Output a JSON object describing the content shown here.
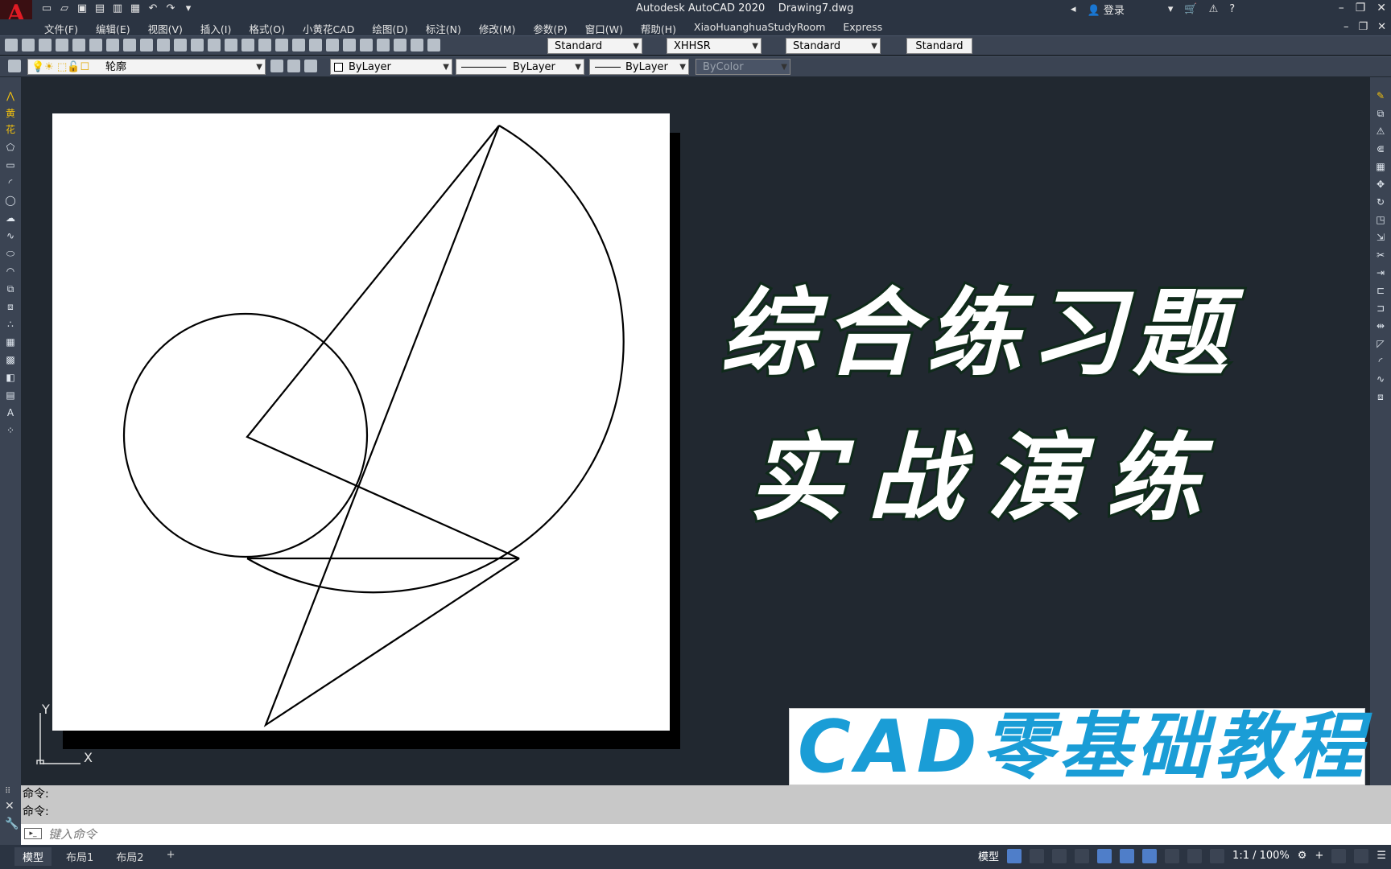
{
  "window": {
    "app_title": "Autodesk AutoCAD 2020",
    "doc_title": "Drawing7.dwg",
    "login": "登录",
    "logo_letter": "A"
  },
  "menu": [
    "文件(F)",
    "编辑(E)",
    "视图(V)",
    "插入(I)",
    "格式(O)",
    "小黄花CAD",
    "绘图(D)",
    "标注(N)",
    "修改(M)",
    "参数(P)",
    "窗口(W)",
    "帮助(H)",
    "XiaoHuanghuaStudyRoom",
    "Express"
  ],
  "styles_toolbar": {
    "text_style": "Standard",
    "dim_style": "XHHSR",
    "table_style": "Standard",
    "multileader_style": "Standard"
  },
  "layers_toolbar": {
    "layer": "轮廓",
    "color": "ByLayer",
    "linetype": "ByLayer",
    "lineweight": "ByLayer",
    "plot_style": "ByColor"
  },
  "left_palette_labels": [
    "黄",
    "花"
  ],
  "overlay": {
    "headline1": "综合练习题",
    "headline2": "实战演练",
    "banner": "CAD零基础教程"
  },
  "ucs": {
    "x_label": "X",
    "y_label": "Y"
  },
  "command": {
    "history": [
      "命令:",
      "命令:"
    ],
    "placeholder": "键入命令"
  },
  "status": {
    "tabs": [
      "模型",
      "布局1",
      "布局2",
      "+"
    ],
    "model_label": "模型",
    "scale": "1:1 / 100%"
  },
  "colors": {
    "background": "#212830",
    "toolbar": "#3b4453",
    "banner_text": "#1a9dd6",
    "logo": "#e01b24"
  }
}
